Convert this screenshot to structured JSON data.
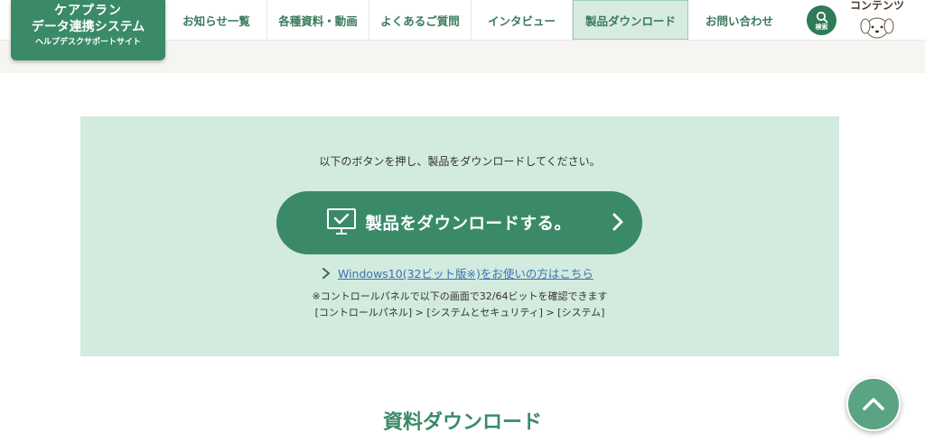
{
  "logo": {
    "line1": "ケアプラン",
    "line2": "データ連携システム",
    "line3": "ヘルプデスクサポートサイト"
  },
  "nav": {
    "items": [
      {
        "label": "お知らせ一覧"
      },
      {
        "label": "各種資料・動画"
      },
      {
        "label": "よくあるご質問"
      },
      {
        "label": "インタビュー"
      },
      {
        "label": "製品ダウンロード",
        "active": true
      },
      {
        "label": "お問い合わせ"
      }
    ],
    "search_label": "検索",
    "contents_label": "コンテンツ"
  },
  "download": {
    "instruction": "以下のボタンを押し、製品をダウンロードしてください。",
    "button_label": "製品をダウンロードする。",
    "win_link": "Windows10(32ビット版※)をお使いの方はこちら",
    "note1": "※コントロールパネルで以下の画面で32/64ビットを確認できます",
    "note2": "[コントロールパネル] > [システムとセキュリティ] > [システム]"
  },
  "section": {
    "title": "資料ダウンロード"
  },
  "colors": {
    "brand": "#3a8a68",
    "box_bg": "#d3eadf",
    "link": "#3a73b0"
  }
}
